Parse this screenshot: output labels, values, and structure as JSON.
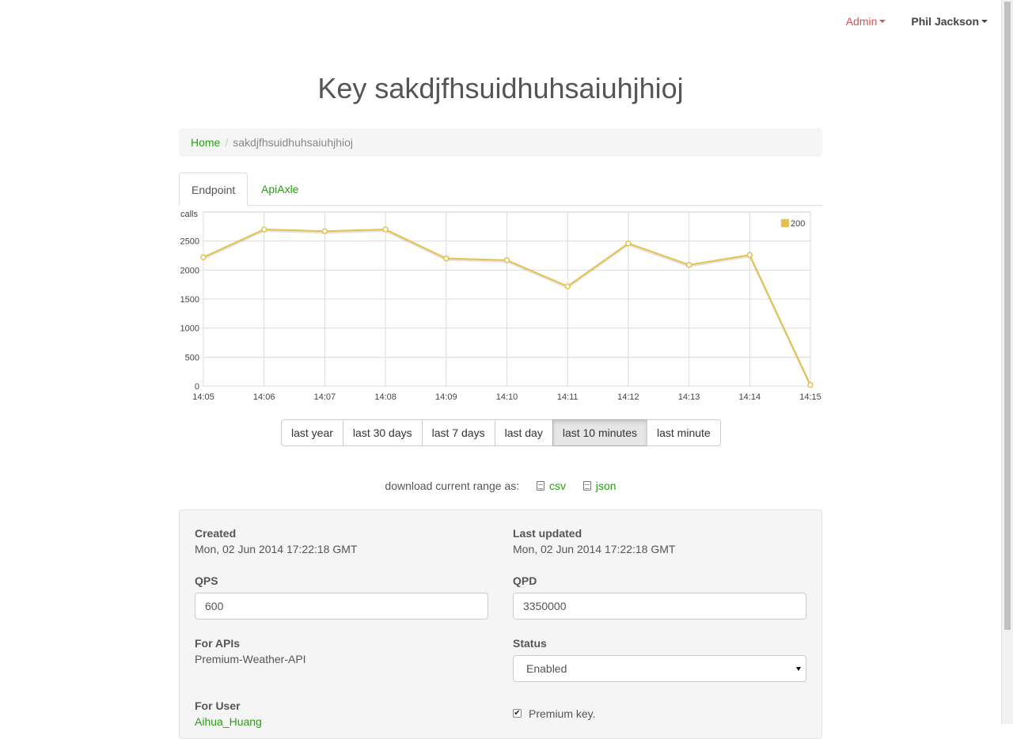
{
  "nav": {
    "admin_label": "Admin",
    "user_label": "Phil Jackson",
    "admin_color": "#d9534f",
    "link_color": "#2a9d14"
  },
  "page_title": "Key sakdjfhsuidhuhsaiuhjhioj",
  "breadcrumb": {
    "home": "Home",
    "current": "sakdjfhsuidhuhsaiuhjhioj"
  },
  "tabs": [
    {
      "label": "Endpoint",
      "active": true
    },
    {
      "label": "ApiAxle",
      "active": false
    }
  ],
  "chart_data": {
    "type": "line",
    "ylabel": "calls",
    "categories": [
      "14:05",
      "14:06",
      "14:07",
      "14:08",
      "14:09",
      "14:10",
      "14:11",
      "14:12",
      "14:13",
      "14:14",
      "14:15"
    ],
    "yticks": [
      0,
      500,
      1000,
      1500,
      2000,
      2500
    ],
    "ylim": [
      0,
      3000
    ],
    "grid": true,
    "legend_position": "top-right",
    "series": [
      {
        "name": "200",
        "color": "#e6c04a",
        "values": [
          2220,
          2700,
          2670,
          2700,
          2200,
          2170,
          1720,
          2460,
          2090,
          2260,
          20
        ]
      }
    ]
  },
  "ranges": [
    "last year",
    "last 30 days",
    "last 7 days",
    "last day",
    "last 10 minutes",
    "last minute"
  ],
  "active_range": "last 10 minutes",
  "download": {
    "prefix": "download current range as:",
    "csv": "csv",
    "json": "json"
  },
  "details": {
    "created_label": "Created",
    "created_value": "Mon, 02 Jun 2014 17:22:18 GMT",
    "updated_label": "Last updated",
    "updated_value": "Mon, 02 Jun 2014 17:22:18 GMT",
    "qps_label": "QPS",
    "qps_value": "600",
    "qpd_label": "QPD",
    "qpd_value": "3350000",
    "apis_label": "For APIs",
    "apis_value": "Premium-Weather-API",
    "status_label": "Status",
    "status_value": "Enabled",
    "user_label": "For User",
    "user_value": "Aihua_Huang",
    "premium_label": "Premium key.",
    "premium_checked": true
  }
}
